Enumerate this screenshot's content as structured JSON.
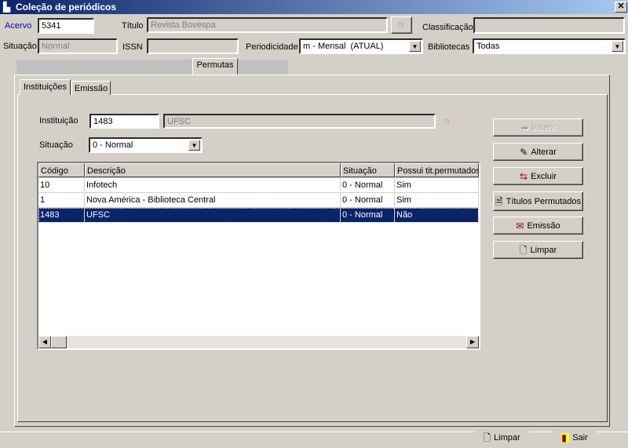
{
  "window": {
    "title": "Coleção de periódicos",
    "close": "✕"
  },
  "header": {
    "acervo_label": "Acervo",
    "acervo_value": "5341",
    "titulo_label": "Título",
    "titulo_value": "Revista Bovespa",
    "classificacao_label": "Classificação",
    "classificacao_value": "",
    "situacao_label": "Situação",
    "situacao_value": "Normal",
    "issn_label": "ISSN",
    "issn_value": "",
    "periodicidade_label": "Periodicidade",
    "periodicidade_value": "m - Mensal  (ATUAL)",
    "bibliotecas_label": "Bibliotecas",
    "bibliotecas_value": "Todas"
  },
  "tabs": {
    "main": "Permutas",
    "sub": [
      "Instituições",
      "Emissão"
    ]
  },
  "form": {
    "instituicao_label": "Instituição",
    "instituicao_code": "1483",
    "instituicao_name": "UFSC",
    "situacao_label": "Situação",
    "situacao_value": "0 - Normal"
  },
  "grid": {
    "columns": [
      "Código",
      "Descrição",
      "Situação",
      "Possui tit.permutados"
    ],
    "rows": [
      [
        "10",
        "Infotech",
        "0 - Normal",
        "Sim"
      ],
      [
        "1",
        "Nova América - Biblioteca Central",
        "0 - Normal",
        "Sim"
      ],
      [
        "1483",
        "UFSC",
        "0 - Normal",
        "Não"
      ]
    ],
    "selected_row": 2
  },
  "buttons": {
    "inserir": "Inserir",
    "alterar": "Alterar",
    "excluir": "Excluir",
    "titulos": "Títulos Permutados",
    "emissao": "Emissão",
    "limpar": "Limpar"
  },
  "footer": {
    "limpar": "Limpar",
    "sair": "Sair"
  }
}
